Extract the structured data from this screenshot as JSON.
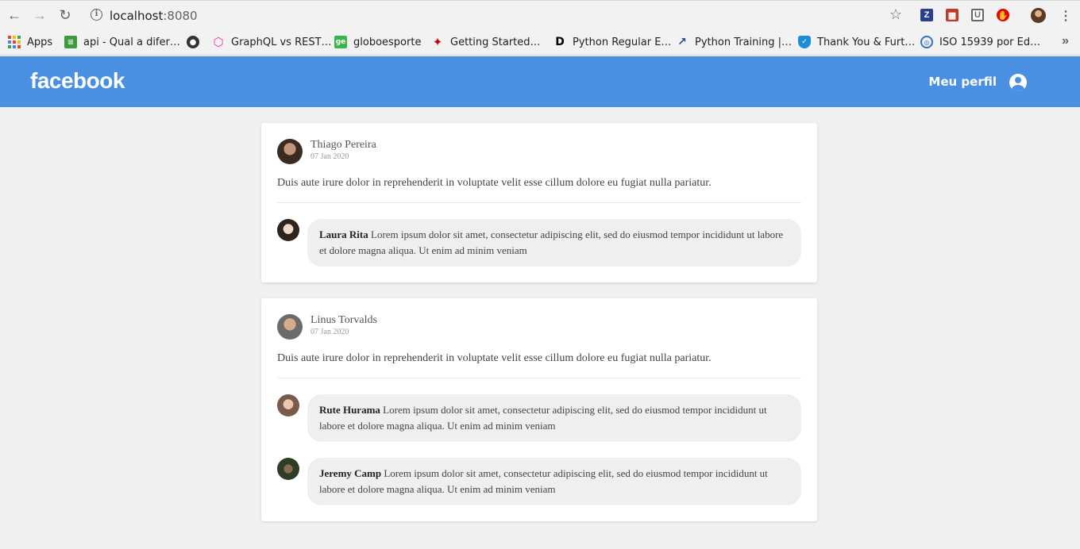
{
  "browser": {
    "url_host": "localhost",
    "url_port": ":8080",
    "bookmarks": [
      {
        "label": "Apps",
        "icon": "apps-grid-icon"
      },
      {
        "label": "api - Qual a difer…",
        "icon": "stackexchange-icon"
      },
      {
        "label": "",
        "icon": "globe-icon"
      },
      {
        "label": "GraphQL vs REST…",
        "icon": "graphql-icon"
      },
      {
        "label": "globoesporte",
        "icon": "ge-icon"
      },
      {
        "label": "Getting Started…",
        "icon": "sailfish-icon"
      },
      {
        "label": "Python Regular E…",
        "icon": "d-letter-icon"
      },
      {
        "label": "Python Training |…",
        "icon": "chart-line-icon"
      },
      {
        "label": "Thank You & Furt…",
        "icon": "shield-icon"
      },
      {
        "label": "ISO 15939 por Ed…",
        "icon": "fingerprint-icon"
      }
    ]
  },
  "header": {
    "logo": "facebook",
    "profile_label": "Meu perfil"
  },
  "posts": [
    {
      "author": "Thiago Pereira",
      "date": "07 Jan 2020",
      "content": "Duis aute irure dolor in reprehenderit in voluptate velit esse cillum dolore eu fugiat nulla pariatur.",
      "comments": [
        {
          "author": "Laura Rita",
          "content": "Lorem ipsum dolor sit amet, consectetur adipiscing elit, sed do eiusmod tempor incididunt ut labore et dolore magna aliqua. Ut enim ad minim veniam"
        }
      ]
    },
    {
      "author": "Linus Torvalds",
      "date": "07 Jan 2020",
      "content": "Duis aute irure dolor in reprehenderit in voluptate velit esse cillum dolore eu fugiat nulla pariatur.",
      "comments": [
        {
          "author": "Rute Hurama",
          "content": "Lorem ipsum dolor sit amet, consectetur adipiscing elit, sed do eiusmod tempor incididunt ut labore et dolore magna aliqua. Ut enim ad minim veniam"
        },
        {
          "author": "Jeremy Camp",
          "content": "Lorem ipsum dolor sit amet, consectetur adipiscing elit, sed do eiusmod tempor incididunt ut labore et dolore magna aliqua. Ut enim ad minim veniam"
        }
      ]
    }
  ],
  "colors": {
    "header": "#4a90e2",
    "background": "#f0f0f0",
    "bubble": "#efefef"
  }
}
